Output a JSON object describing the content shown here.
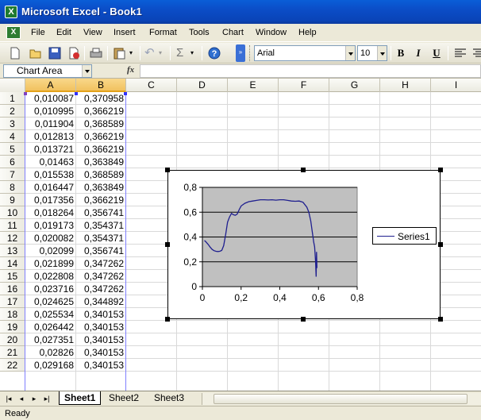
{
  "window": {
    "title": "Microsoft Excel - Book1",
    "app_icon": "excel-icon"
  },
  "menu": {
    "items": [
      "File",
      "Edit",
      "View",
      "Insert",
      "Format",
      "Tools",
      "Chart",
      "Window",
      "Help"
    ]
  },
  "toolbar": {
    "font_name": "Arial",
    "font_size": "10",
    "bold": "B",
    "italic": "I",
    "underline": "U"
  },
  "formula": {
    "name_box": "Chart Area",
    "fx_label": "fx",
    "value": ""
  },
  "sheet": {
    "columns": [
      "A",
      "B",
      "C",
      "D",
      "E",
      "F",
      "G",
      "H",
      "I"
    ],
    "rows": [
      "1",
      "2",
      "3",
      "4",
      "5",
      "6",
      "7",
      "8",
      "9",
      "10",
      "11",
      "12",
      "13",
      "14",
      "15",
      "16",
      "17",
      "18",
      "19",
      "20",
      "21",
      "22"
    ],
    "col_a": [
      "0,010087",
      "0,010995",
      "0,011904",
      "0,012813",
      "0,013721",
      "0,01463",
      "0,015538",
      "0,016447",
      "0,017356",
      "0,018264",
      "0,019173",
      "0,020082",
      "0,02099",
      "0,021899",
      "0,022808",
      "0,023716",
      "0,024625",
      "0,025534",
      "0,026442",
      "0,027351",
      "0,02826",
      "0,029168"
    ],
    "col_b": [
      "0,370958",
      "0,366219",
      "0,368589",
      "0,366219",
      "0,366219",
      "0,363849",
      "0,368589",
      "0,363849",
      "0,366219",
      "0,356741",
      "0,354371",
      "0,354371",
      "0,356741",
      "0,347262",
      "0,347262",
      "0,347262",
      "0,344892",
      "0,340153",
      "0,340153",
      "0,340153",
      "0,340153",
      "0,340153"
    ]
  },
  "chart_data": {
    "type": "line",
    "xticks": [
      "0",
      "0,2",
      "0,4",
      "0,6",
      "0,8"
    ],
    "yticks": [
      "0",
      "0,2",
      "0,4",
      "0,6",
      "0,8"
    ],
    "xlim": [
      0,
      0.8
    ],
    "ylim": [
      0,
      0.8
    ],
    "grid": true,
    "legend_position": "right",
    "plot_area_color": "#c0c0c0",
    "series": [
      {
        "name": "Series1",
        "color": "#1f1f8f",
        "x": [
          0.010087,
          0.015,
          0.02,
          0.03,
          0.04,
          0.05,
          0.06,
          0.07,
          0.08,
          0.09,
          0.1,
          0.11,
          0.12,
          0.13,
          0.14,
          0.15,
          0.16,
          0.17,
          0.18,
          0.19,
          0.2,
          0.22,
          0.24,
          0.26,
          0.28,
          0.3,
          0.32,
          0.34,
          0.36,
          0.38,
          0.4,
          0.42,
          0.44,
          0.46,
          0.48,
          0.5,
          0.52,
          0.54,
          0.55,
          0.56,
          0.57,
          0.575,
          0.58,
          0.585,
          0.588,
          0.59,
          0.592
        ],
        "y": [
          0.370958,
          0.366,
          0.357,
          0.34,
          0.318,
          0.3,
          0.29,
          0.285,
          0.283,
          0.285,
          0.292,
          0.33,
          0.42,
          0.52,
          0.56,
          0.59,
          0.58,
          0.575,
          0.585,
          0.62,
          0.65,
          0.672,
          0.685,
          0.69,
          0.695,
          0.7,
          0.7,
          0.698,
          0.7,
          0.697,
          0.7,
          0.7,
          0.695,
          0.69,
          0.688,
          0.69,
          0.68,
          0.64,
          0.6,
          0.53,
          0.42,
          0.36,
          0.32,
          0.2,
          0.08,
          0.28,
          0.15
        ]
      }
    ]
  },
  "tabs": {
    "sheets": [
      "Sheet1",
      "Sheet2",
      "Sheet3"
    ]
  },
  "status": {
    "text": "Ready"
  }
}
